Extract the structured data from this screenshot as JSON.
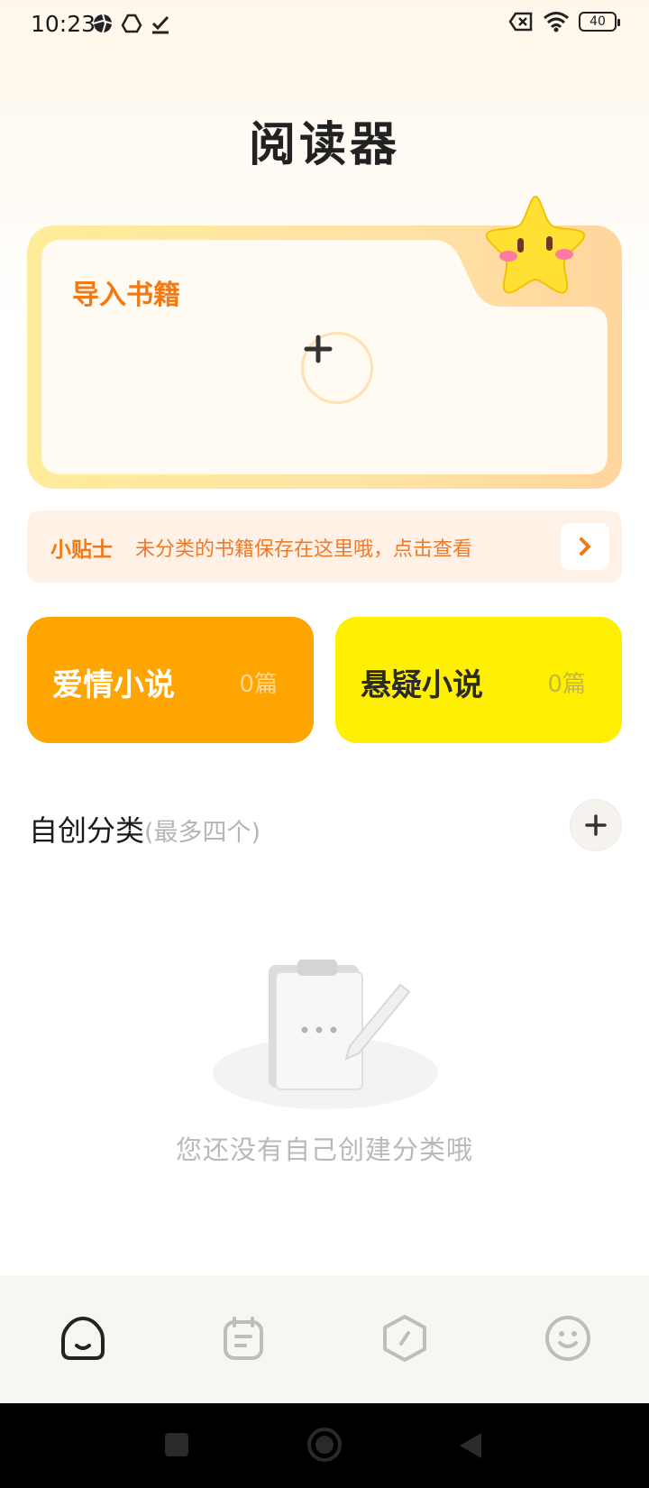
{
  "status_bar": {
    "time": "10:23",
    "battery": "40"
  },
  "title": "阅读器",
  "import_card": {
    "label": "导入书籍"
  },
  "tip": {
    "tag": "小贴士",
    "text": "未分类的书籍保存在这里哦，点击查看"
  },
  "categories": [
    {
      "name": "爱情小说",
      "count": "0篇",
      "color": "#ffa502"
    },
    {
      "name": "悬疑小说",
      "count": "0篇",
      "color": "#ffef00"
    }
  ],
  "custom_section": {
    "title": "自创分类",
    "hint": "(最多四个)",
    "empty_text": "您还没有自己创建分类哦"
  },
  "tabs": [
    {
      "icon": "home-icon",
      "active": true
    },
    {
      "icon": "notes-icon",
      "active": false
    },
    {
      "icon": "compass-icon",
      "active": false
    },
    {
      "icon": "profile-icon",
      "active": false
    }
  ],
  "colors": {
    "accent_orange": "#f07a16",
    "romance_card": "#ffa502",
    "mystery_card": "#ffef00"
  }
}
